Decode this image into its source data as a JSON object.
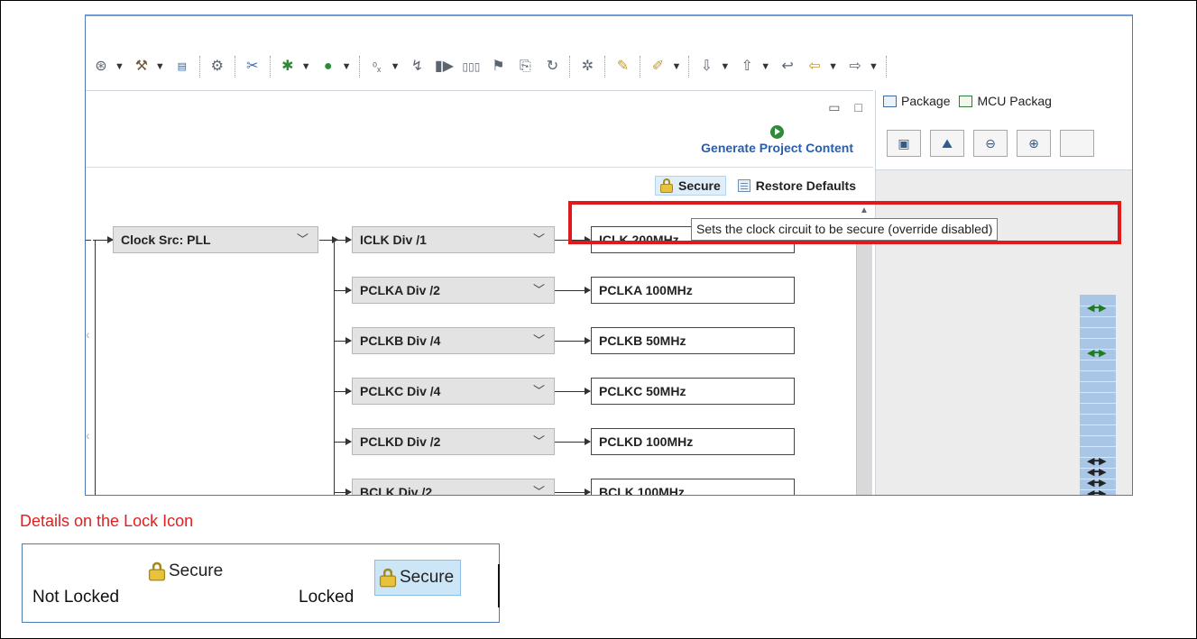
{
  "left_pane": {
    "generate_label": "Generate Project Content",
    "secure_label": "Secure",
    "restore_label": "Restore Defaults"
  },
  "clock_tree": {
    "source": "Clock Src: PLL",
    "rows": [
      {
        "divider": "ICLK Div /1",
        "output": "ICLK 200MHz"
      },
      {
        "divider": "PCLKA Div /2",
        "output": "PCLKA 100MHz"
      },
      {
        "divider": "PCLKB Div /4",
        "output": "PCLKB 50MHz"
      },
      {
        "divider": "PCLKC Div /4",
        "output": "PCLKC 50MHz"
      },
      {
        "divider": "PCLKD Div /2",
        "output": "PCLKD 100MHz"
      },
      {
        "divider": "BCLK Div /2",
        "output": "BCLK 100MHz"
      }
    ]
  },
  "tooltip": "Sets the clock circuit to be secure (override disabled)",
  "right_pane": {
    "tabs": [
      "Package",
      "MCU Packag"
    ]
  },
  "details": {
    "title": "Details on the Lock Icon",
    "not_locked_label": "Not Locked",
    "locked_label": "Locked",
    "secure_label": "Secure"
  },
  "colors": {
    "highlight": "#e01a1a",
    "link_blue": "#2a5ea8",
    "locked_bg": "#cde6f7"
  }
}
